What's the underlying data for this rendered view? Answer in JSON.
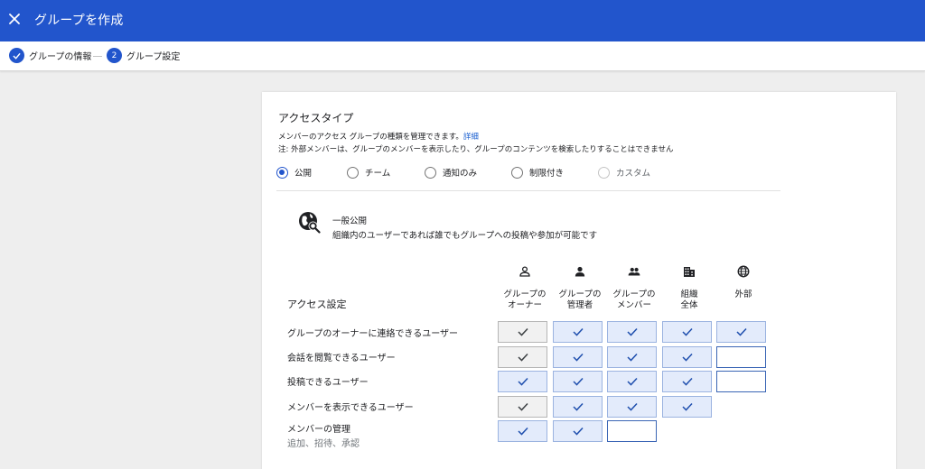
{
  "header": {
    "title": "グループを作成"
  },
  "stepper": {
    "steps": [
      {
        "label": "グループの情報",
        "state": "done"
      },
      {
        "label": "グループ設定",
        "number": "2",
        "state": "active"
      }
    ]
  },
  "access_type": {
    "title": "アクセスタイプ",
    "description": "メンバーのアクセス グループの種類を管理できます。",
    "details_link": "詳細",
    "note": "注: 外部メンバーは、グループのメンバーを表示したり、グループのコンテンツを検索したりすることはできません",
    "options": [
      {
        "label": "公開",
        "selected": true
      },
      {
        "label": "チーム",
        "selected": false
      },
      {
        "label": "通知のみ",
        "selected": false
      },
      {
        "label": "制限付き",
        "selected": false
      },
      {
        "label": "カスタム",
        "selected": false,
        "disabled": true
      }
    ],
    "selected_summary": {
      "title": "一般公開",
      "description": "組織内のユーザーであれば誰でもグループへの投稿や参加が可能です"
    }
  },
  "access_settings": {
    "title": "アクセス設定",
    "columns": [
      {
        "line1": "グループの",
        "line2": "オーナー",
        "icon": "person-outline-icon"
      },
      {
        "line1": "グループの",
        "line2": "管理者",
        "icon": "person-icon"
      },
      {
        "line1": "グループの",
        "line2": "メンバー",
        "icon": "group-icon"
      },
      {
        "line1": "組織",
        "line2": "全体",
        "icon": "building-icon"
      },
      {
        "line1": "外部",
        "line2": "",
        "icon": "globe-icon"
      }
    ],
    "rows": [
      {
        "label": "グループのオーナーに連絡できるユーザー",
        "sublabel": "",
        "cells": [
          "locked",
          "on",
          "on",
          "on",
          "on"
        ]
      },
      {
        "label": "会話を閲覧できるユーザー",
        "sublabel": "",
        "cells": [
          "locked",
          "on",
          "on",
          "on",
          "off"
        ]
      },
      {
        "label": "投稿できるユーザー",
        "sublabel": "",
        "cells": [
          "on",
          "on",
          "on",
          "on",
          "off"
        ]
      },
      {
        "label": "メンバーを表示できるユーザー",
        "sublabel": "",
        "cells": [
          "locked",
          "on",
          "on",
          "on",
          "none"
        ]
      },
      {
        "label": "メンバーの管理",
        "sublabel": "追加、招待、承認",
        "cells": [
          "on",
          "on",
          "off",
          "none",
          "none"
        ]
      }
    ]
  },
  "colors": {
    "primary": "#2255cc",
    "cell_on_bg": "#e3ebfb",
    "cell_locked_bg": "#f1f1f1",
    "check_blue": "#1f4fae",
    "check_dark": "#3c4043"
  }
}
